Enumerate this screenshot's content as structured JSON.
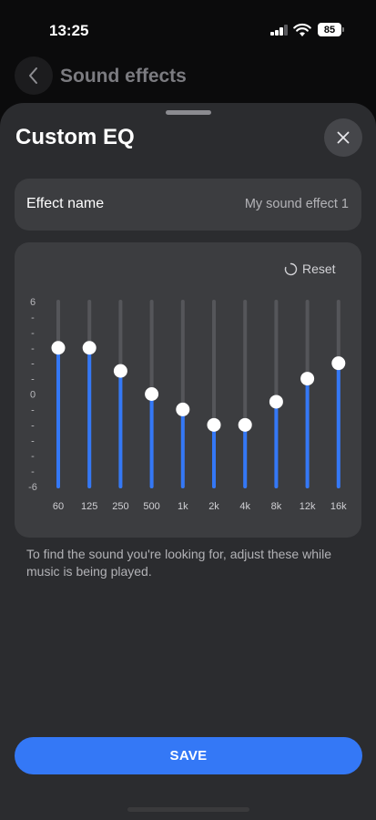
{
  "status_bar": {
    "time": "13:25",
    "battery": "85"
  },
  "background": {
    "title": "Sound effects"
  },
  "sheet": {
    "title": "Custom EQ",
    "effect_name_label": "Effect name",
    "effect_name_value": "My sound effect 1",
    "reset_label": "Reset",
    "hint": "To find the sound you're looking for, adjust these while music is being played.",
    "save_label": "SAVE"
  },
  "chart_data": {
    "type": "bar",
    "categories": [
      "60",
      "125",
      "250",
      "500",
      "1k",
      "2k",
      "4k",
      "8k",
      "12k",
      "16k"
    ],
    "values": [
      3,
      3,
      1.5,
      0,
      -1,
      -2,
      -2,
      -0.5,
      1,
      2
    ],
    "ylim": [
      -6,
      6
    ],
    "ytick_top": "6",
    "ytick_mid": "0",
    "ytick_bottom": "-6",
    "ytick_minor": "-",
    "colors": {
      "track": "#55565a",
      "fill": "#3478f6",
      "knob": "#ffffff"
    }
  },
  "icons": {
    "back": "chevron-left-icon",
    "close": "close-icon",
    "reset": "reset-icon"
  }
}
